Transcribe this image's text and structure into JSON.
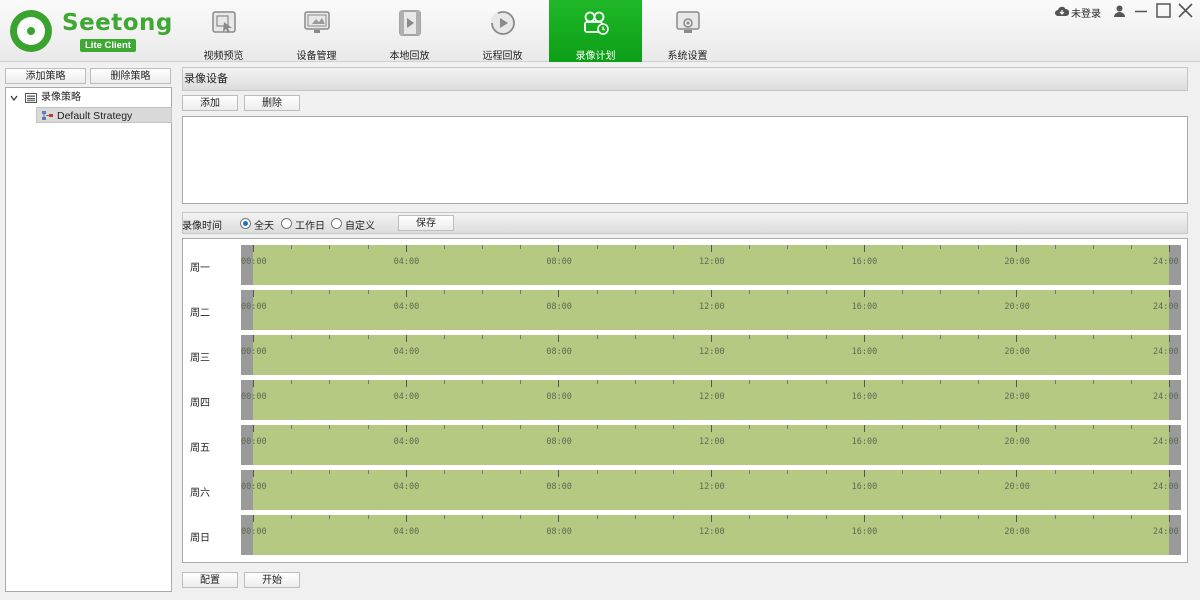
{
  "app": {
    "logo_name": "Seetong",
    "logo_badge": "Lite Client",
    "login_status": "未登录"
  },
  "nav": {
    "tabs": [
      {
        "label": "视频预览",
        "icon": "video-preview-icon"
      },
      {
        "label": "设备管理",
        "icon": "device-manage-icon"
      },
      {
        "label": "本地回放",
        "icon": "local-playback-icon"
      },
      {
        "label": "远程回放",
        "icon": "remote-playback-icon"
      },
      {
        "label": "录像计划",
        "icon": "record-plan-icon",
        "active": true
      },
      {
        "label": "系统设置",
        "icon": "system-settings-icon"
      }
    ],
    "active_color": "#16ad21"
  },
  "left": {
    "add_label": "添加策略",
    "delete_label": "删除策略",
    "tree": {
      "root_label": "录像策略",
      "child_label": "Default Strategy"
    }
  },
  "record_device": {
    "title": "录像设备",
    "add_label": "添加",
    "delete_label": "删除"
  },
  "record_time": {
    "label": "录像时间",
    "options": [
      "全天",
      "工作日",
      "自定义"
    ],
    "selected": "全天",
    "save_label": "保存"
  },
  "schedule": {
    "days": [
      "周一",
      "周二",
      "周三",
      "周四",
      "周五",
      "周六",
      "周日"
    ],
    "hour_labels": [
      "00:00",
      "04:00",
      "08:00",
      "12:00",
      "16:00",
      "20:00",
      "24:00"
    ],
    "fill_color": "#b5c983"
  },
  "footer": {
    "config_label": "配置",
    "start_label": "开始"
  }
}
